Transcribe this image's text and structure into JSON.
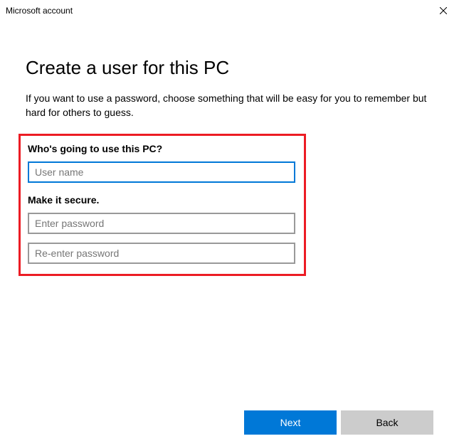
{
  "titlebar": {
    "title": "Microsoft account"
  },
  "main": {
    "heading": "Create a user for this PC",
    "subtext": "If you want to use a password, choose something that will be easy for you to remember but hard for others to guess."
  },
  "form": {
    "section1_label": "Who's going to use this PC?",
    "username_placeholder": "User name",
    "username_value": "",
    "section2_label": "Make it secure.",
    "password_placeholder": "Enter password",
    "password_value": "",
    "password2_placeholder": "Re-enter password",
    "password2_value": ""
  },
  "footer": {
    "next_label": "Next",
    "back_label": "Back"
  }
}
